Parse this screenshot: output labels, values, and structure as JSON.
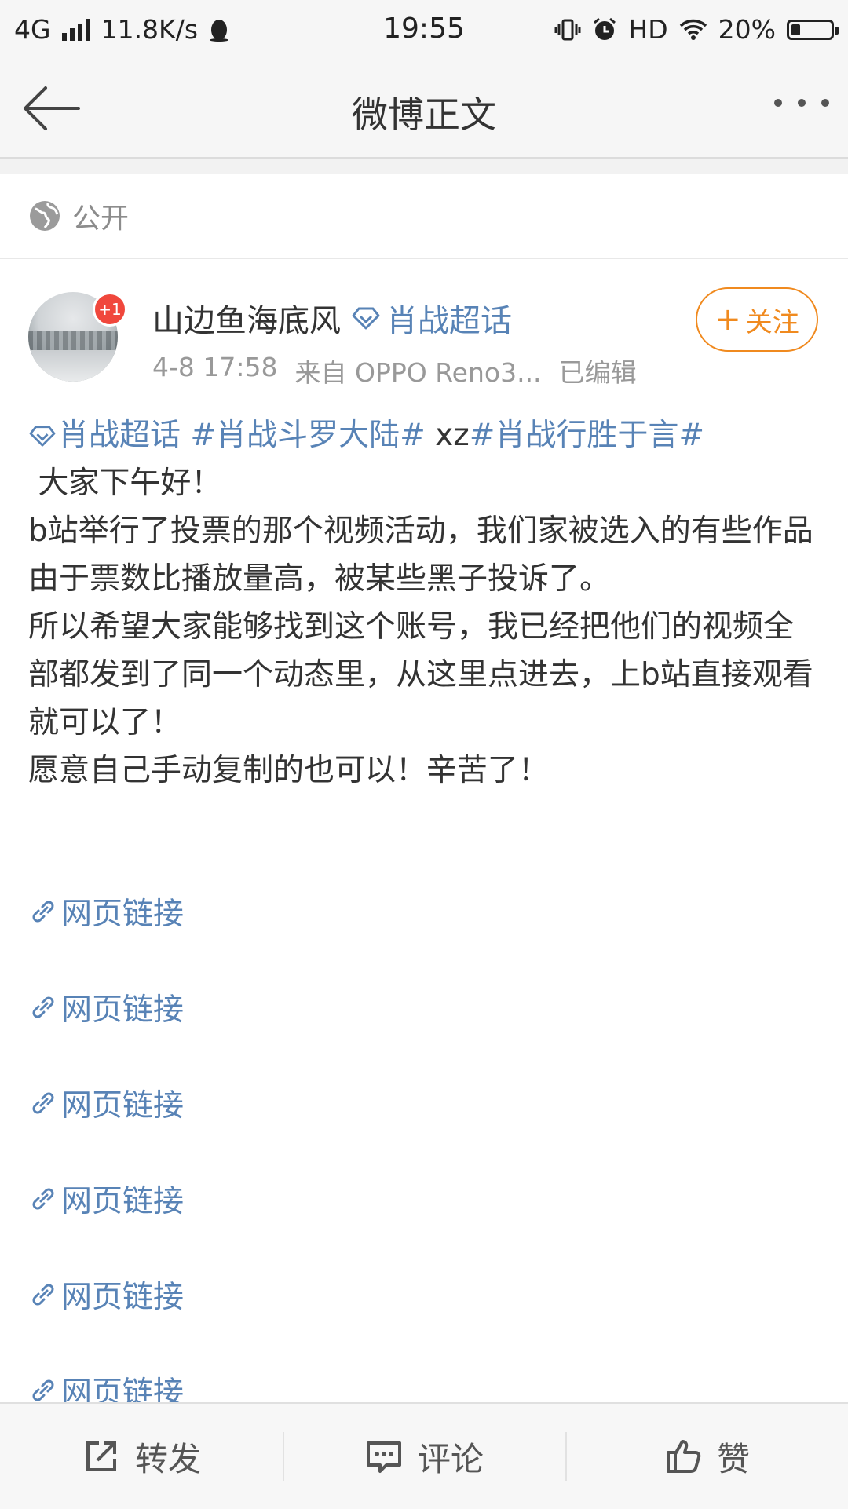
{
  "status_bar": {
    "network": "4G",
    "speed": "11.8K/s",
    "time": "19:55",
    "hd": "HD",
    "battery": "20%",
    "battery_level": 0.2,
    "icons": [
      "signal-icon",
      "qq-penguin-icon",
      "vibrate-icon",
      "alarm-icon",
      "wifi-icon",
      "battery-charging-icon"
    ]
  },
  "nav": {
    "title": "微博正文",
    "back_icon": "back-arrow-icon",
    "more_icon": "more-dots-icon"
  },
  "visibility": {
    "icon": "globe-icon",
    "label": "公开"
  },
  "post": {
    "author": {
      "name": "山边鱼海底风",
      "badge": "+1",
      "supertopic_icon": "diamond-icon",
      "supertopic": "肖战超话",
      "avatar_icon": "avatar-snow-landscape"
    },
    "meta": {
      "time": "4-8 17:58",
      "source": "来自 OPPO Reno3...",
      "edited": "已编辑"
    },
    "follow_button": {
      "plus": "+",
      "label": "关注",
      "color": "#f08a1f"
    },
    "tags": {
      "super": "肖战超话",
      "tag1": "#肖战斗罗大陆#",
      "plain": " xz",
      "tag2": "#肖战行胜于言#"
    },
    "lines": [
      " 大家下午好！",
      "b站举行了投票的那个视频活动，我们家被选入的有些作品由于票数比播放量高，被某些黑子投诉了。",
      "所以希望大家能够找到这个账号，我已经把他们的视频全部都发到了同一个动态里，从这里点进去，上b站直接观看就可以了！",
      "愿意自己手动复制的也可以！辛苦了！"
    ],
    "links": [
      "网页链接",
      "网页链接",
      "网页链接",
      "网页链接",
      "网页链接",
      "网页链接"
    ],
    "link_icon": "link-chain-icon",
    "link_color": "#5883b6"
  },
  "actions": {
    "repost": "转发",
    "comment": "评论",
    "like": "赞",
    "icons": [
      "share-out-icon",
      "comment-bubble-icon",
      "thumbs-up-icon"
    ]
  }
}
